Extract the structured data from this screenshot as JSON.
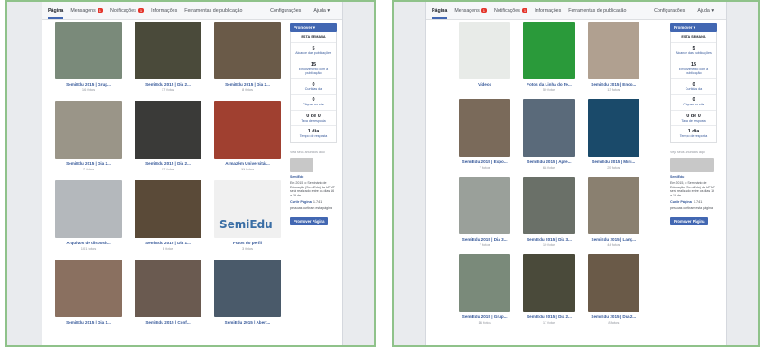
{
  "left": {
    "tabs": [
      {
        "label": "Página",
        "active": true
      },
      {
        "label": "Mensagens",
        "badge": "1"
      },
      {
        "label": "Notificações",
        "badge": "1"
      },
      {
        "label": "Informações"
      },
      {
        "label": "Ferramentas de publicação"
      }
    ],
    "settings": "Configurações",
    "help": "Ajuda ▾",
    "photos": [
      {
        "title": "SemiEdu 2015 | Grup...",
        "count": "16 fotos",
        "tone": "#7a8a7a"
      },
      {
        "title": "SemiEdu 2015 | Dia 2...",
        "count": "17 fotos",
        "tone": "#4a4a3a"
      },
      {
        "title": "SemiEdu 2015 | Dia 2...",
        "count": "8 fotos",
        "tone": "#6a5a48"
      },
      {
        "title": "SemiEdu 2015 | Dia 2...",
        "count": "7 fotos",
        "tone": "#9a9588"
      },
      {
        "title": "SemiEdu 2015 | Dia 2...",
        "count": "17 fotos",
        "tone": "#3a3a38"
      },
      {
        "title": "Armazém Universitár...",
        "count": "11 fotos",
        "tone": "#a04030"
      },
      {
        "title": "Arquivos de disposit...",
        "count": "101 fotos",
        "tone": "#b4b8bc"
      },
      {
        "title": "SemiEdu 2015 | Dia 1...",
        "count": "3 fotos",
        "tone": "#5a4a38"
      },
      {
        "title": "Fotos do perfil",
        "count": "3 fotos",
        "tone": "#f0f0f0",
        "logo": "SemiEdu"
      },
      {
        "title": "SemiEdu 2015 | Dia 1...",
        "count": "",
        "tone": "#8a7060"
      },
      {
        "title": "SemiEdu 2015 | Conf...",
        "count": "",
        "tone": "#6a5a50"
      },
      {
        "title": "SemiEdu 2015 | Abert...",
        "count": "",
        "tone": "#4a5a6a"
      }
    ],
    "sidebar": {
      "promote": "Promover ▾",
      "week": "ESTA SEMANA",
      "stats": [
        {
          "value": "5",
          "label": "Alcance das publicações"
        },
        {
          "value": "15",
          "label": "Envolvimento com a publicação"
        },
        {
          "value": "0",
          "label": "Curtidas da"
        },
        {
          "value": "0",
          "label": "Cliques no site"
        },
        {
          "value": "0 de 0",
          "label": "Taxa de resposta"
        },
        {
          "value": "1 dia",
          "label": "Tempo de resposta"
        }
      ],
      "note": "Veja seus anúncios aqui",
      "name": "SemiEdu",
      "desc": "Em 2015, o Seminário de Educação (SemiEdu) da UFMT será realizado entre os dias 16 a 19 de...",
      "like": "Curtir Página",
      "like_count": "1.741",
      "like_sub": "pessoas curtiram esta página",
      "promote_page": "Promover Página"
    }
  },
  "right": {
    "tabs": [
      {
        "label": "Página",
        "active": true
      },
      {
        "label": "Mensagens",
        "badge": "1"
      },
      {
        "label": "Notificações",
        "badge": "1"
      },
      {
        "label": "Informações"
      },
      {
        "label": "Ferramentas de publicação"
      }
    ],
    "settings": "Configurações",
    "help": "Ajuda ▾",
    "photos": [
      {
        "title": "Vídeos",
        "count": "",
        "tone": "#e8ebe8",
        "video": true
      },
      {
        "title": "Fotos da Linha do Te...",
        "count": "50 fotos",
        "tone": "#2a9a3a"
      },
      {
        "title": "SemiEdu 2015 | Enco...",
        "count": "13 fotos",
        "tone": "#b0a090"
      },
      {
        "title": "SemiEdu 2015 | Expo...",
        "count": "7 fotos",
        "tone": "#7a6a5a"
      },
      {
        "title": "SemiEdu 2015 | Apre...",
        "count": "68 fotos",
        "tone": "#5a6a7a"
      },
      {
        "title": "SemiEdu 2015 | Mini...",
        "count": "25 fotos",
        "tone": "#1a4a6a"
      },
      {
        "title": "SemiEdu 2015 | Dia 3...",
        "count": "7 fotos",
        "tone": "#9aa09a"
      },
      {
        "title": "SemiEdu 2015 | Dia 3...",
        "count": "10 fotos",
        "tone": "#6a7068"
      },
      {
        "title": "SemiEdu 2015 | Lanç...",
        "count": "44 fotos",
        "tone": "#8a8070"
      },
      {
        "title": "SemiEdu 2015 | Grup...",
        "count": "16 fotos",
        "tone": "#7a8a7a"
      },
      {
        "title": "SemiEdu 2015 | Dia 2...",
        "count": "17 fotos",
        "tone": "#4a4a3a"
      },
      {
        "title": "SemiEdu 2015 | Dia 2...",
        "count": "8 fotos",
        "tone": "#6a5a48"
      }
    ],
    "sidebar": {
      "promote": "Promover ▾",
      "week": "ESTA SEMANA",
      "stats": [
        {
          "value": "5",
          "label": "Alcance das publicações"
        },
        {
          "value": "15",
          "label": "Envolvimento com a publicação"
        },
        {
          "value": "0",
          "label": "Curtidas da"
        },
        {
          "value": "0",
          "label": "Cliques no site"
        },
        {
          "value": "0 de 0",
          "label": "Taxa de resposta"
        },
        {
          "value": "1 dia",
          "label": "Tempo de resposta"
        }
      ],
      "note": "Veja seus anúncios aqui",
      "name": "SemiEdu",
      "desc": "Em 2015, o Seminário de Educação (SemiEdu) da UFMT será realizado entre os dias 16 a 19 de...",
      "like": "Curtir Página",
      "like_count": "1.741",
      "like_sub": "pessoas curtiram esta página",
      "promote_page": "Promover Página"
    }
  }
}
